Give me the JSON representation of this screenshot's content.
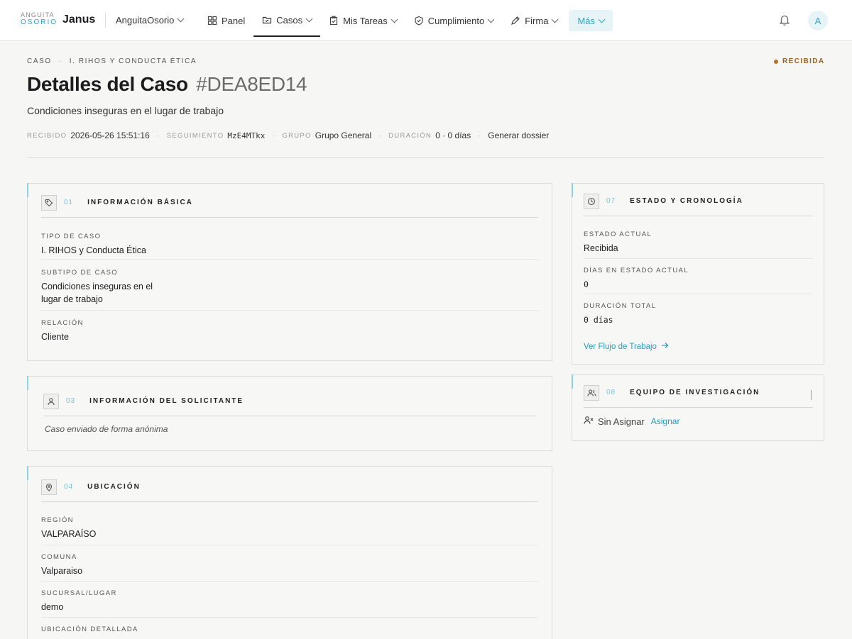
{
  "app": {
    "logo_top": "ANGUITA",
    "logo_bottom": "OSORIO",
    "name": "Janus",
    "org": "AnguitaOsorio",
    "avatar_initial": "A"
  },
  "nav": {
    "panel": "Panel",
    "casos": "Casos",
    "tareas": "Mis Tareas",
    "cumplimiento": "Cumplimiento",
    "firma": "Firma",
    "mas": "Más"
  },
  "header": {
    "crumb_1": "CASO",
    "crumb_sep": "·",
    "crumb_2": "I. RIHOS Y CONDUCTA ÉTICA",
    "status": "RECIBIDA",
    "title": "Detalles del Caso",
    "code": "#DEA8ED14",
    "subtitle": "Condiciones inseguras en el lugar de trabajo",
    "meta": {
      "received_label": "RECIBIDO",
      "received_value": "2026-05-26 15:51:16",
      "tracking_label": "SEGUIMIENTO",
      "tracking_value": "MzE4MTkx",
      "group_label": "GRUPO",
      "group_value": "Grupo General",
      "duration_label": "DURACIÓN",
      "duration_value": "0 · 0 días",
      "dossier": "Generar dossier",
      "sep": "·"
    }
  },
  "basic": {
    "num": "01",
    "title": "INFORMACIÓN BÁSICA",
    "type_label": "TIPO DE CASO",
    "type_value": "I. RIHOS y Conducta Ética",
    "subtype_label": "SUBTIPO DE CASO",
    "subtype_value_1": "Condiciones inseguras en el",
    "subtype_value_2": "lugar de trabajo",
    "relation_label": "RELACIÓN",
    "relation_value": "Cliente"
  },
  "requester": {
    "num": "03",
    "title": "INFORMACIÓN DEL SOLICITANTE",
    "anon": "Caso enviado de forma anónima"
  },
  "location": {
    "num": "04",
    "title": "UBICACIÓN",
    "region_label": "REGIÓN",
    "region_value": "VALPARAÍSO",
    "comuna_label": "COMUNA",
    "comuna_value": "Valparaiso",
    "branch_label": "SUCURSAL/LUGAR",
    "branch_value": "demo",
    "detail_label": "UBICACIÓN DETALLADA"
  },
  "status_card": {
    "num": "07",
    "title": "ESTADO Y CRONOLOGÍA",
    "current_label": "ESTADO ACTUAL",
    "current_value": "Recibida",
    "days_label": "DÍAS EN ESTADO ACTUAL",
    "days_value": "0",
    "total_label": "DURACIÓN TOTAL",
    "total_value": "0 días",
    "workflow_link": "Ver Flujo de Trabajo"
  },
  "team": {
    "num": "08",
    "title": "EQUIPO DE INVESTIGACIÓN",
    "unassigned": "Sin Asignar",
    "assign": "Asignar"
  },
  "colors": {
    "accent": "#2aa7c6",
    "status": "#a4621b",
    "card_accent": "#8fd0e1"
  }
}
